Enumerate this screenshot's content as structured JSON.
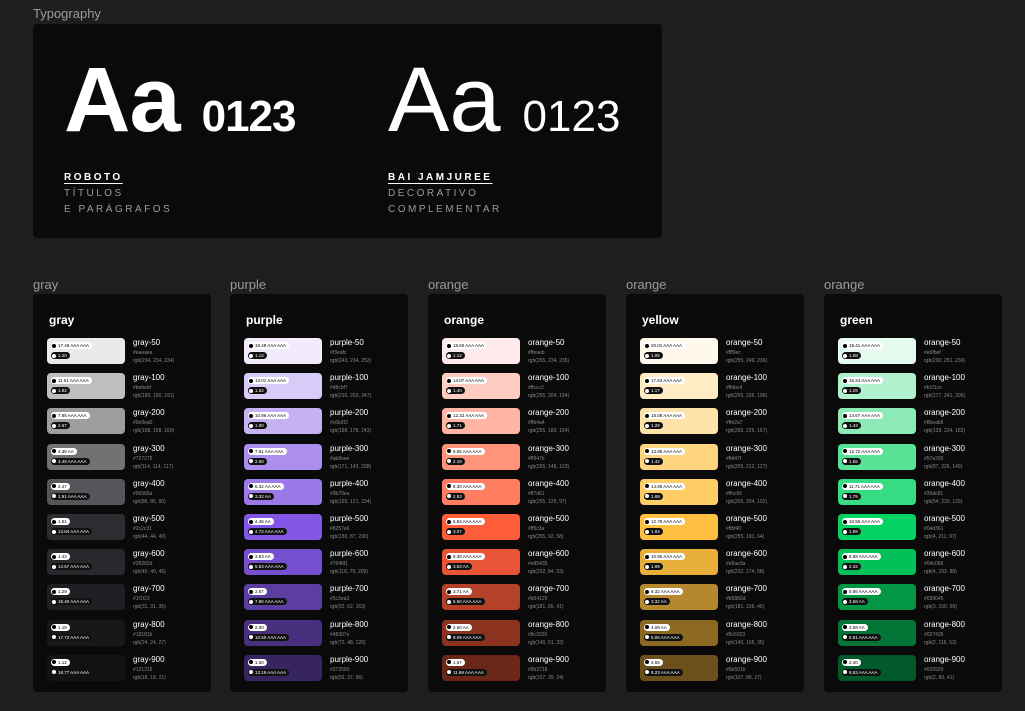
{
  "typography": {
    "frame_label": "Typography",
    "fonts": [
      {
        "specimen": "Aa",
        "digits": "0123",
        "name": "ROBOTO",
        "usage": [
          "TÍTULOS",
          "E PARÁGRAFOS"
        ]
      },
      {
        "specimen": "Aa",
        "digits": "0123",
        "name": "BAI JAMJUREE",
        "usage": [
          "DECORATIVO",
          "COMPLEMENTAR"
        ]
      }
    ]
  },
  "palettes": [
    {
      "frame_label": "gray",
      "title": "gray",
      "swatches": [
        {
          "name": "gray-50",
          "hex": "#eaeaea",
          "rgb": "rgb(234, 234, 234)",
          "color": "#eaeaea",
          "pill1": "17.46 AAA AAA",
          "pill2": "1.20",
          "pill1_style": "light",
          "pill2_style": "dark"
        },
        {
          "name": "gray-100",
          "hex": "#bebebf",
          "rgb": "rgb(190, 190, 191)",
          "color": "#bebebf",
          "pill1": "11.51 AAA AAA",
          "pill2": "1.82",
          "pill1_style": "light",
          "pill2_style": "dark"
        },
        {
          "name": "gray-200",
          "hex": "#9e9ea0",
          "rgb": "rgb(158, 158, 160)",
          "color": "#9e9ea0",
          "pill1": "7.85 AAA AAA",
          "pill2": "2.67",
          "pill1_style": "light",
          "pill2_style": "dark"
        },
        {
          "name": "gray-300",
          "hex": "#727275",
          "rgb": "rgb(114, 114, 117)",
          "color": "#727275",
          "pill1": "4.38 AA",
          "pill2": "4.49 AAA AAA",
          "pill1_style": "light",
          "pill2_style": "dark"
        },
        {
          "name": "gray-400",
          "hex": "#56565a",
          "rgb": "rgb(86, 86, 90)",
          "color": "#56565a",
          "pill1": "2.47",
          "pill2": "1.91 AAA AAA",
          "pill1_style": "light",
          "pill2_style": "dark"
        },
        {
          "name": "gray-500",
          "hex": "#2c2c31",
          "rgb": "rgb(44, 44, 49)",
          "color": "#2c2c31",
          "pill1": "1.51",
          "pill2": "13.84 AAA AAA",
          "pill1_style": "light",
          "pill2_style": "dark"
        },
        {
          "name": "gray-600",
          "hex": "#28282d",
          "rgb": "rgb(40, 40, 45)",
          "color": "#28282d",
          "pill1": "1.43",
          "pill2": "14.67 AAA AAA",
          "pill1_style": "light",
          "pill2_style": "dark"
        },
        {
          "name": "gray-700",
          "hex": "#1f1f23",
          "rgb": "rgb(31, 31, 35)",
          "color": "#1f1f23",
          "pill1": "1.29",
          "pill2": "16.40 AAA AAA",
          "pill1_style": "light",
          "pill2_style": "dark"
        },
        {
          "name": "gray-800",
          "hex": "#18181b",
          "rgb": "rgb(24, 24, 27)",
          "color": "#18181b",
          "pill1": "1.19",
          "pill2": "17.72 AAA AAA",
          "pill1_style": "light",
          "pill2_style": "dark"
        },
        {
          "name": "gray-900",
          "hex": "#121215",
          "rgb": "rgb(18, 18, 21)",
          "color": "#121215",
          "pill1": "1.12",
          "pill2": "18.77 AAA AAA",
          "pill1_style": "light",
          "pill2_style": "dark"
        }
      ]
    },
    {
      "frame_label": "purple",
      "title": "purple",
      "swatches": [
        {
          "name": "purple-50",
          "hex": "#f3eafc",
          "rgb": "rgb(243, 234, 252)",
          "color": "#f3eafc",
          "pill1": "18.48 AAA AAA",
          "pill2": "1.14",
          "pill1_style": "light",
          "pill2_style": "dark"
        },
        {
          "name": "purple-100",
          "hex": "#d8cbf7",
          "rgb": "rgb(216, 203, 247)",
          "color": "#d8cbf7",
          "pill1": "13.01 AAA AAA",
          "pill2": "1.52",
          "pill1_style": "light",
          "pill2_style": "dark"
        },
        {
          "name": "purple-200",
          "hex": "#c6b2f3",
          "rgb": "rgb(198, 178, 243)",
          "color": "#c6b2f3",
          "pill1": "10.96 AAA AAA",
          "pill2": "1.90",
          "pill1_style": "light",
          "pill2_style": "dark"
        },
        {
          "name": "purple-300",
          "hex": "#ab8eee",
          "rgb": "rgb(171, 142, 238)",
          "color": "#ab8eee",
          "pill1": "7.81 AAA AAA",
          "pill2": "2.68",
          "pill1_style": "light",
          "pill2_style": "dark"
        },
        {
          "name": "purple-400",
          "hex": "#9b79ea",
          "rgb": "rgb(155, 121, 234)",
          "color": "#9b79ea",
          "pill1": "6.32 AA AAA",
          "pill2": "3.32 AA",
          "pill1_style": "light",
          "pill2_style": "dark"
        },
        {
          "name": "purple-500",
          "hex": "#8257e6",
          "rgb": "rgb(130, 87, 230)",
          "color": "#8257e6",
          "pill1": "4.46 AA",
          "pill2": "4.72 AAA AAA",
          "pill1_style": "light",
          "pill2_style": "dark"
        },
        {
          "name": "purple-600",
          "hex": "#764fd1",
          "rgb": "rgb(118, 79, 209)",
          "color": "#764fd1",
          "pill1": "3.83 AA",
          "pill2": "5.53 AAA AAA",
          "pill1_style": "light",
          "pill2_style": "dark"
        },
        {
          "name": "purple-700",
          "hex": "#5c3ea3",
          "rgb": "rgb(92, 62, 163)",
          "color": "#5c3ea3",
          "pill1": "2.67",
          "pill2": "7.86 AAA AAA",
          "pill1_style": "light",
          "pill2_style": "dark"
        },
        {
          "name": "purple-800",
          "hex": "#48307e",
          "rgb": "rgb(72, 48, 126)",
          "color": "#48307e",
          "pill1": "2.00",
          "pill2": "10.50 AAA AAA",
          "pill1_style": "light",
          "pill2_style": "dark"
        },
        {
          "name": "purple-900",
          "hex": "#372560",
          "rgb": "rgb(55, 37, 96)",
          "color": "#372560",
          "pill1": "1.60",
          "pill2": "13.19 AAA AAA",
          "pill1_style": "light",
          "pill2_style": "dark"
        }
      ]
    },
    {
      "frame_label": "orange",
      "title": "orange",
      "swatches": [
        {
          "name": "orange-50",
          "hex": "#ffeaeb",
          "rgb": "rgb(255, 234, 235)",
          "color": "#ffeaeb",
          "pill1": "18.60 AAA AAA",
          "pill2": "1.12",
          "pill1_style": "light",
          "pill2_style": "dark"
        },
        {
          "name": "orange-100",
          "hex": "#ffccc2",
          "rgb": "rgb(255, 204, 194)",
          "color": "#ffccc2",
          "pill1": "14.07 AAA AAA",
          "pill2": "1.40",
          "pill1_style": "light",
          "pill2_style": "dark"
        },
        {
          "name": "orange-200",
          "hex": "#ffb4a4",
          "rgb": "rgb(255, 180, 164)",
          "color": "#ffb4a4",
          "pill1": "12.32 AAA AAA",
          "pill2": "1.71",
          "pill1_style": "light",
          "pill2_style": "dark"
        },
        {
          "name": "orange-300",
          "hex": "#ff947b",
          "rgb": "rgb(255, 148, 123)",
          "color": "#ff947b",
          "pill1": "8.65 AAA AAA",
          "pill2": "2.19",
          "pill1_style": "light",
          "pill2_style": "dark"
        },
        {
          "name": "orange-400",
          "hex": "#ff7d61",
          "rgb": "rgb(255, 125, 97)",
          "color": "#ff7d61",
          "pill1": "8.30 AAA AAA",
          "pill2": "2.53",
          "pill1_style": "light",
          "pill2_style": "dark"
        },
        {
          "name": "orange-500",
          "hex": "#ff5c3a",
          "rgb": "rgb(255, 92, 58)",
          "color": "#ff5c3a",
          "pill1": "5.84 AAA AAA",
          "pill2": "3.07",
          "pill1_style": "light",
          "pill2_style": "dark"
        },
        {
          "name": "orange-600",
          "hex": "#e85435",
          "rgb": "rgb(232, 84, 53)",
          "color": "#e85435",
          "pill1": "5.30 AAA AAA",
          "pill2": "3.63 AA",
          "pill1_style": "light",
          "pill2_style": "dark"
        },
        {
          "name": "orange-700",
          "hex": "#b54129",
          "rgb": "rgb(181, 65, 41)",
          "color": "#b54129",
          "pill1": "3.71 AA",
          "pill2": "5.60 AAA AAA",
          "pill1_style": "light",
          "pill2_style": "dark"
        },
        {
          "name": "orange-800",
          "hex": "#8c3320",
          "rgb": "rgb(140, 51, 32)",
          "color": "#8c3320",
          "pill1": "2.50 AA",
          "pill2": "8.09 AAA AAA",
          "pill1_style": "light",
          "pill2_style": "dark"
        },
        {
          "name": "orange-900",
          "hex": "#6b2718",
          "rgb": "rgb(107, 39, 24)",
          "color": "#6b2718",
          "pill1": "1.67",
          "pill2": "11.69 AAA AAA",
          "pill1_style": "light",
          "pill2_style": "dark"
        }
      ]
    },
    {
      "frame_label": "orange",
      "title": "yellow",
      "swatches": [
        {
          "name": "orange-50",
          "hex": "#fff9ec",
          "rgb": "rgb(255, 249, 236)",
          "color": "#fff9ec",
          "pill1": "20.01 AAA AAA",
          "pill2": "1.05",
          "pill1_style": "light",
          "pill2_style": "dark"
        },
        {
          "name": "orange-100",
          "hex": "#ffebc4",
          "rgb": "rgb(255, 235, 196)",
          "color": "#ffebc4",
          "pill1": "17.63 AAA AAA",
          "pill2": "1.17",
          "pill1_style": "light",
          "pill2_style": "dark"
        },
        {
          "name": "orange-200",
          "hex": "#ffe2a7",
          "rgb": "rgb(255, 226, 167)",
          "color": "#ffe2a7",
          "pill1": "16.08 AAA AAA",
          "pill2": "1.29",
          "pill1_style": "light",
          "pill2_style": "dark"
        },
        {
          "name": "orange-300",
          "hex": "#ffd47f",
          "rgb": "rgb(255, 212, 127)",
          "color": "#ffd47f",
          "pill1": "13.88 AAA AAA",
          "pill2": "1.42",
          "pill1_style": "light",
          "pill2_style": "dark"
        },
        {
          "name": "orange-400",
          "hex": "#ffcc66",
          "rgb": "rgb(255, 204, 102)",
          "color": "#ffcc66",
          "pill1": "14.88 AAA AAA",
          "pill2": "1.69",
          "pill1_style": "light",
          "pill2_style": "dark"
        },
        {
          "name": "orange-500",
          "hex": "#ffbf40",
          "rgb": "rgb(255, 191, 64)",
          "color": "#ffbf40",
          "pill1": "12.78 AAA AAA",
          "pill2": "1.84",
          "pill1_style": "light",
          "pill2_style": "dark"
        },
        {
          "name": "orange-600",
          "hex": "#e8ae3a",
          "rgb": "rgb(232, 174, 58)",
          "color": "#e8ae3a",
          "pill1": "10.55 AAA AAA",
          "pill2": "1.99",
          "pill1_style": "light",
          "pill2_style": "dark"
        },
        {
          "name": "orange-700",
          "hex": "#b5882d",
          "rgb": "rgb(181, 136, 45)",
          "color": "#b5882d",
          "pill1": "6.32 AAA AAA",
          "pill2": "3.32 AA",
          "pill1_style": "light",
          "pill2_style": "dark"
        },
        {
          "name": "orange-800",
          "hex": "#8c6923",
          "rgb": "rgb(140, 105, 35)",
          "color": "#8c6923",
          "pill1": "4.09 AA",
          "pill2": "5.05 AAA AAA",
          "pill1_style": "light",
          "pill2_style": "dark"
        },
        {
          "name": "orange-900",
          "hex": "#6b501b",
          "rgb": "rgb(107, 80, 27)",
          "color": "#6b501b",
          "pill1": "2.55",
          "pill2": "8.23 AAA AAA",
          "pill1_style": "light",
          "pill2_style": "dark"
        }
      ]
    },
    {
      "frame_label": "orange",
      "title": "green",
      "swatches": [
        {
          "name": "orange-50",
          "hex": "#e6fbef",
          "rgb": "rgb(230, 251, 239)",
          "color": "#e6fbef",
          "pill1": "19.41 AAA AAA",
          "pill2": "1.08",
          "pill1_style": "light",
          "pill2_style": "dark"
        },
        {
          "name": "orange-100",
          "hex": "#b1f1ce",
          "rgb": "rgb(177, 241, 206)",
          "color": "#b1f1ce",
          "pill1": "16.24 AAA AAA",
          "pill2": "1.29",
          "pill1_style": "light",
          "pill2_style": "dark"
        },
        {
          "name": "orange-200",
          "hex": "#8beab6",
          "rgb": "rgb(139, 234, 182)",
          "color": "#8beab6",
          "pill1": "14.67 AAA AAA",
          "pill2": "1.43",
          "pill1_style": "light",
          "pill2_style": "dark"
        },
        {
          "name": "orange-300",
          "hex": "#57e295",
          "rgb": "rgb(87, 226, 149)",
          "color": "#57e295",
          "pill1": "12.72 AAA AAA",
          "pill2": "1.65",
          "pill1_style": "light",
          "pill2_style": "dark"
        },
        {
          "name": "orange-400",
          "hex": "#36dc81",
          "rgb": "rgb(54, 220, 129)",
          "color": "#36dc81",
          "pill1": "11.71 AAA AAA",
          "pill2": "1.79",
          "pill1_style": "light",
          "pill2_style": "dark"
        },
        {
          "name": "orange-500",
          "hex": "#04d361",
          "rgb": "rgb(4, 211, 97)",
          "color": "#04d361",
          "pill1": "10.55 AAA AAA",
          "pill2": "1.99",
          "pill1_style": "light",
          "pill2_style": "dark"
        },
        {
          "name": "orange-600",
          "hex": "#04c058",
          "rgb": "rgb(4, 192, 88)",
          "color": "#04c058",
          "pill1": "8.69 AAA AAA",
          "pill2": "2.42",
          "pill1_style": "light",
          "pill2_style": "dark"
        },
        {
          "name": "orange-700",
          "hex": "#039645",
          "rgb": "rgb(3, 150, 69)",
          "color": "#039645",
          "pill1": "5.86 AAA AAA",
          "pill2": "3.58 AA",
          "pill1_style": "light",
          "pill2_style": "dark"
        },
        {
          "name": "orange-800",
          "hex": "#027435",
          "rgb": "rgb(2, 116, 53)",
          "color": "#027435",
          "pill1": "3.59 AA",
          "pill2": "5.81 AAA AAA",
          "pill1_style": "light",
          "pill2_style": "dark"
        },
        {
          "name": "orange-900",
          "hex": "#025929",
          "rgb": "rgb(2, 89, 41)",
          "color": "#025929",
          "pill1": "2.40",
          "pill2": "8.63 AAA AAA",
          "pill1_style": "light",
          "pill2_style": "dark"
        }
      ]
    }
  ]
}
